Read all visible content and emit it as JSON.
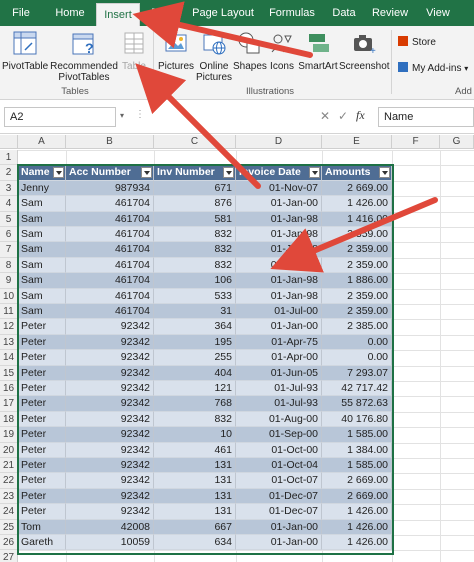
{
  "ribbon_tabs": [
    {
      "label": "File",
      "active": false
    },
    {
      "label": "Home",
      "active": false
    },
    {
      "label": "Insert",
      "active": true
    },
    {
      "label": "Draw",
      "active": false
    },
    {
      "label": "Page Layout",
      "active": false
    },
    {
      "label": "Formulas",
      "active": false
    },
    {
      "label": "Data",
      "active": false
    },
    {
      "label": "Review",
      "active": false
    },
    {
      "label": "View",
      "active": false
    }
  ],
  "ribbon": {
    "pivottable": "PivotTable",
    "recommended_line1": "Recommended",
    "recommended_line2": "PivotTables",
    "table": "Table",
    "tables_group": "Tables",
    "pictures": "Pictures",
    "online_line1": "Online",
    "online_line2": "Pictures",
    "shapes": "Shapes",
    "icons": "Icons",
    "smartart": "SmartArt",
    "screenshot": "Screenshot",
    "illustrations_group": "Illustrations",
    "store": "Store",
    "my_addins": "My Add-ins",
    "addins_group": "Add"
  },
  "formula_bar": {
    "name_box": "A2",
    "fx": "fx",
    "value": "Name"
  },
  "columns": [
    "A",
    "B",
    "C",
    "D",
    "E",
    "F",
    "G"
  ],
  "row_numbers": [
    "1",
    "2",
    "3",
    "4",
    "5",
    "6",
    "7",
    "8",
    "9",
    "10",
    "11",
    "12",
    "13",
    "14",
    "15",
    "16",
    "17",
    "18",
    "19",
    "20",
    "21",
    "22",
    "23",
    "24",
    "25",
    "26",
    "27"
  ],
  "table": {
    "headers": [
      "Name",
      "Acc Number",
      "Inv  Number",
      "Invoice Date",
      "Amounts"
    ],
    "rows": [
      [
        "Jenny",
        "987934",
        "671",
        "01-Nov-07",
        "2 669.00"
      ],
      [
        "Sam",
        "461704",
        "876",
        "01-Jan-00",
        "1 426.00"
      ],
      [
        "Sam",
        "461704",
        "581",
        "01-Jan-98",
        "1 416.00"
      ],
      [
        "Sam",
        "461704",
        "832",
        "01-Jan-98",
        "2 359.00"
      ],
      [
        "Sam",
        "461704",
        "832",
        "01-Jan-98",
        "2 359.00"
      ],
      [
        "Sam",
        "461704",
        "832",
        "01-Jan-98",
        "2 359.00"
      ],
      [
        "Sam",
        "461704",
        "106",
        "01-Jan-98",
        "1 886.00"
      ],
      [
        "Sam",
        "461704",
        "533",
        "01-Jan-98",
        "2 359.00"
      ],
      [
        "Sam",
        "461704",
        "31",
        "01-Jul-00",
        "2 359.00"
      ],
      [
        "Peter",
        "92342",
        "364",
        "01-Jan-00",
        "2 385.00"
      ],
      [
        "Peter",
        "92342",
        "195",
        "01-Apr-75",
        "0.00"
      ],
      [
        "Peter",
        "92342",
        "255",
        "01-Apr-00",
        "0.00"
      ],
      [
        "Peter",
        "92342",
        "404",
        "01-Jun-05",
        "7 293.07"
      ],
      [
        "Peter",
        "92342",
        "121",
        "01-Jul-93",
        "42 717.42"
      ],
      [
        "Peter",
        "92342",
        "768",
        "01-Jul-93",
        "55 872.63"
      ],
      [
        "Peter",
        "92342",
        "832",
        "01-Aug-00",
        "40 176.80"
      ],
      [
        "Peter",
        "92342",
        "10",
        "01-Sep-00",
        "1 585.00"
      ],
      [
        "Peter",
        "92342",
        "461",
        "01-Oct-00",
        "1 384.00"
      ],
      [
        "Peter",
        "92342",
        "131",
        "01-Oct-04",
        "1 585.00"
      ],
      [
        "Peter",
        "92342",
        "131",
        "01-Oct-07",
        "2 669.00"
      ],
      [
        "Peter",
        "92342",
        "131",
        "01-Dec-07",
        "2 669.00"
      ],
      [
        "Peter",
        "92342",
        "131",
        "01-Dec-07",
        "1 426.00"
      ],
      [
        "Tom",
        "42008",
        "667",
        "01-Jan-00",
        "1 426.00"
      ],
      [
        "Gareth",
        "10059",
        "634",
        "01-Jan-00",
        "1 426.00"
      ]
    ]
  },
  "colors": {
    "excel_green": "#217346",
    "table_header": "#4f6d94",
    "band_dark": "#b8c6d8",
    "band_light": "#d9e1ec",
    "annotation_arrow": "#e0483a"
  }
}
